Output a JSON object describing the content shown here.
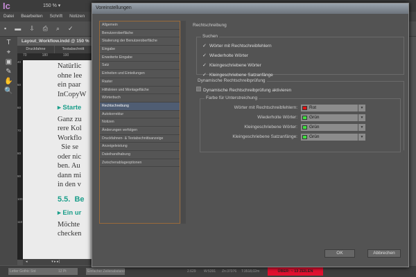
{
  "app": {
    "logo": "Ic",
    "zoom": "150 %",
    "menu": [
      "Datei",
      "Bearbeiten",
      "Schrift",
      "Notizen"
    ],
    "toolbar_icons": [
      "save-icon",
      "open-icon",
      "export-icon",
      "print-icon",
      "search-icon",
      "spellcheck-icon"
    ],
    "tools": [
      "T",
      "⌖",
      "▣",
      "✎",
      "✋",
      "🔍"
    ],
    "doc_tab": "Layout_Workflow.indd @ 150 %",
    "sub_tabs": [
      "Druckfahne",
      "Textabschnitt"
    ],
    "ruler": [
      "70",
      "180",
      "190"
    ],
    "vruler": [
      "40",
      "50",
      "60",
      "70",
      "80",
      "90",
      "100",
      "110"
    ],
    "page_text": {
      "l1": "Natürlic",
      "l2": "ohne lee",
      "l3": "ein paar",
      "l4": "InCopyW",
      "h1": "▸ Starte",
      "l5": "Ganz zu",
      "l6": "rere Kol",
      "l7": "Workflo",
      "l8": "  Sie se",
      "l9": "oder nic",
      "l10": "ben. Au",
      "l11": "dann mi",
      "l12": "in den v",
      "h2": "5.5.  Be",
      "h3": "▸ Ein ur",
      "l13": "Möchte",
      "l14": "checken"
    },
    "status": {
      "font": "Letter Gothic Std",
      "size": "12 Pt",
      "leading": "Einfacher Zeilenabstand",
      "line": "2.629",
      "words": "W:5391",
      "chars": "Zn:37076",
      "depth": "T:3518,02m",
      "overset": "ÜBER:  ~ 13 ZEILEN"
    }
  },
  "dialog": {
    "title": "Voreinstellungen",
    "categories": [
      "Allgemein",
      "Benutzeroberfläche",
      "Skalierung der Benutzeroberfläche",
      "Eingabe",
      "Erweiterte Eingabe",
      "Satz",
      "Einheiten und Einteilungen",
      "Raster",
      "Hilfslinien und Montagefläche",
      "Wörterbuch",
      "Rechtschreibung",
      "Autokorrektur",
      "Notizen",
      "Änderungen verfolgen",
      "Druckfahnen- & Textabschnittsanzeige",
      "Anzeigeleistung",
      "Dateihandhabung",
      "Zwischenablageoptionen"
    ],
    "selected": "Rechtschreibung",
    "section_title": "Rechtschreibung",
    "search": {
      "label": "Suchen",
      "options": [
        {
          "label": "Wörter mit Rechtschreibfehlern",
          "checked": true
        },
        {
          "label": "Wiederholte Wörter",
          "checked": true
        },
        {
          "label": "Kleingeschriebene Wörter",
          "checked": true
        },
        {
          "label": "Kleingeschriebene Satzanfänge",
          "checked": true
        }
      ]
    },
    "dynamic": {
      "label": "Dynamische Rechtschreibprüfung",
      "enable_label": "Dynamische Rechtschreibprüfung aktivieren",
      "enabled": false,
      "underline_label": "Farbe für Unterstreichung",
      "colors": [
        {
          "label": "Wörter mit Rechtschreibfehlern:",
          "value": "Rot",
          "swatch": "#e01010"
        },
        {
          "label": "Wiederholte Wörter:",
          "value": "Grün",
          "swatch": "#40e040"
        },
        {
          "label": "Kleingeschriebene Wörter:",
          "value": "Grün",
          "swatch": "#40e040"
        },
        {
          "label": "Kleingeschriebene Satzanfänge:",
          "value": "Grün",
          "swatch": "#40e040"
        }
      ]
    },
    "ok": "OK",
    "cancel": "Abbrechen"
  }
}
